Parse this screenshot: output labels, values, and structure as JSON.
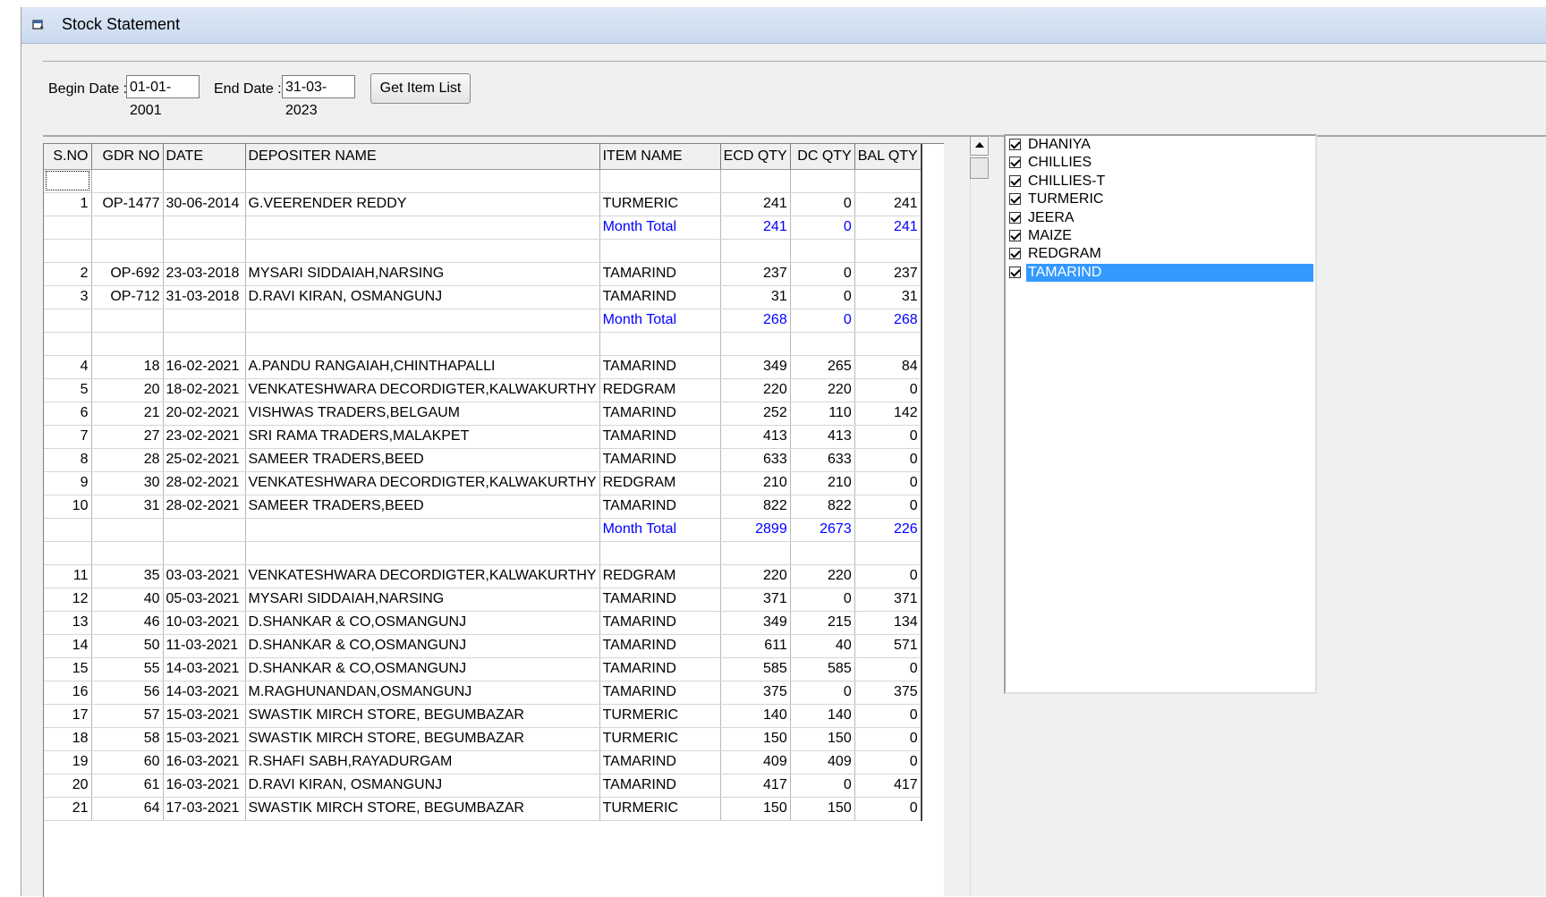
{
  "window": {
    "title": "Stock Statement",
    "icon": "form-icon"
  },
  "filters": {
    "begin_label": "Begin Date :",
    "begin_value": "01-01-2001",
    "end_label": "End Date :",
    "end_value": "31-03-2023",
    "button_label": "Get Item List"
  },
  "grid": {
    "columns": [
      "S.NO",
      "GDR NO",
      "DATE",
      "DEPOSITER NAME",
      "ITEM NAME",
      "ECD QTY",
      "DC QTY",
      "BAL QTY"
    ],
    "rows": [
      {
        "type": "blank",
        "cells": [
          "",
          "",
          "",
          "",
          "",
          "",
          "",
          ""
        ]
      },
      {
        "type": "data",
        "cells": [
          "1",
          "OP-1477",
          "30-06-2014",
          "G.VEERENDER REDDY",
          "TURMERIC",
          "241",
          "0",
          "241"
        ]
      },
      {
        "type": "total",
        "cells": [
          "",
          "",
          "",
          "",
          "Month Total",
          "241",
          "0",
          "241"
        ]
      },
      {
        "type": "blank",
        "cells": [
          "",
          "",
          "",
          "",
          "",
          "",
          "",
          ""
        ]
      },
      {
        "type": "data",
        "cells": [
          "2",
          "OP-692",
          "23-03-2018",
          "MYSARI SIDDAIAH,NARSING",
          "TAMARIND",
          "237",
          "0",
          "237"
        ]
      },
      {
        "type": "data",
        "cells": [
          "3",
          "OP-712",
          "31-03-2018",
          "D.RAVI KIRAN, OSMANGUNJ",
          "TAMARIND",
          "31",
          "0",
          "31"
        ]
      },
      {
        "type": "total",
        "cells": [
          "",
          "",
          "",
          "",
          "Month Total",
          "268",
          "0",
          "268"
        ]
      },
      {
        "type": "blank",
        "cells": [
          "",
          "",
          "",
          "",
          "",
          "",
          "",
          ""
        ]
      },
      {
        "type": "data",
        "cells": [
          "4",
          "18",
          "16-02-2021",
          "A.PANDU RANGAIAH,CHINTHAPALLI",
          "TAMARIND",
          "349",
          "265",
          "84"
        ]
      },
      {
        "type": "data",
        "cells": [
          "5",
          "20",
          "18-02-2021",
          "VENKATESHWARA DECORDIGTER,KALWAKURTHY",
          "REDGRAM",
          "220",
          "220",
          "0"
        ]
      },
      {
        "type": "data",
        "cells": [
          "6",
          "21",
          "20-02-2021",
          "VISHWAS TRADERS,BELGAUM",
          "TAMARIND",
          "252",
          "110",
          "142"
        ]
      },
      {
        "type": "data",
        "cells": [
          "7",
          "27",
          "23-02-2021",
          "SRI RAMA TRADERS,MALAKPET",
          "TAMARIND",
          "413",
          "413",
          "0"
        ]
      },
      {
        "type": "data",
        "cells": [
          "8",
          "28",
          "25-02-2021",
          "SAMEER TRADERS,BEED",
          "TAMARIND",
          "633",
          "633",
          "0"
        ]
      },
      {
        "type": "data",
        "cells": [
          "9",
          "30",
          "28-02-2021",
          "VENKATESHWARA DECORDIGTER,KALWAKURTHY",
          "REDGRAM",
          "210",
          "210",
          "0"
        ]
      },
      {
        "type": "data",
        "cells": [
          "10",
          "31",
          "28-02-2021",
          "SAMEER TRADERS,BEED",
          "TAMARIND",
          "822",
          "822",
          "0"
        ]
      },
      {
        "type": "total",
        "cells": [
          "",
          "",
          "",
          "",
          "Month Total",
          "2899",
          "2673",
          "226"
        ]
      },
      {
        "type": "blank",
        "cells": [
          "",
          "",
          "",
          "",
          "",
          "",
          "",
          ""
        ]
      },
      {
        "type": "data",
        "cells": [
          "11",
          "35",
          "03-03-2021",
          "VENKATESHWARA DECORDIGTER,KALWAKURTHY",
          "REDGRAM",
          "220",
          "220",
          "0"
        ]
      },
      {
        "type": "data",
        "cells": [
          "12",
          "40",
          "05-03-2021",
          "MYSARI SIDDAIAH,NARSING",
          "TAMARIND",
          "371",
          "0",
          "371"
        ]
      },
      {
        "type": "data",
        "cells": [
          "13",
          "46",
          "10-03-2021",
          "D.SHANKAR & CO,OSMANGUNJ",
          "TAMARIND",
          "349",
          "215",
          "134"
        ]
      },
      {
        "type": "data",
        "cells": [
          "14",
          "50",
          "11-03-2021",
          "D.SHANKAR & CO,OSMANGUNJ",
          "TAMARIND",
          "611",
          "40",
          "571"
        ]
      },
      {
        "type": "data",
        "cells": [
          "15",
          "55",
          "14-03-2021",
          "D.SHANKAR & CO,OSMANGUNJ",
          "TAMARIND",
          "585",
          "585",
          "0"
        ]
      },
      {
        "type": "data",
        "cells": [
          "16",
          "56",
          "14-03-2021",
          "M.RAGHUNANDAN,OSMANGUNJ",
          "TAMARIND",
          "375",
          "0",
          "375"
        ]
      },
      {
        "type": "data",
        "cells": [
          "17",
          "57",
          "15-03-2021",
          "SWASTIK MIRCH STORE, BEGUMBAZAR",
          "TURMERIC",
          "140",
          "140",
          "0"
        ]
      },
      {
        "type": "data",
        "cells": [
          "18",
          "58",
          "15-03-2021",
          "SWASTIK MIRCH STORE, BEGUMBAZAR",
          "TURMERIC",
          "150",
          "150",
          "0"
        ]
      },
      {
        "type": "data",
        "cells": [
          "19",
          "60",
          "16-03-2021",
          "R.SHAFI SABH,RAYADURGAM",
          "TAMARIND",
          "409",
          "409",
          "0"
        ]
      },
      {
        "type": "data",
        "cells": [
          "20",
          "61",
          "16-03-2021",
          "D.RAVI KIRAN, OSMANGUNJ",
          "TAMARIND",
          "417",
          "0",
          "417"
        ]
      },
      {
        "type": "data",
        "cells": [
          "21",
          "64",
          "17-03-2021",
          "SWASTIK MIRCH STORE, BEGUMBAZAR",
          "TURMERIC",
          "150",
          "150",
          "0"
        ]
      }
    ]
  },
  "items": [
    {
      "label": "DHANIYA",
      "checked": true,
      "selected": false
    },
    {
      "label": "CHILLIES",
      "checked": true,
      "selected": false
    },
    {
      "label": "CHILLIES-T",
      "checked": true,
      "selected": false
    },
    {
      "label": "TURMERIC",
      "checked": true,
      "selected": false
    },
    {
      "label": "JEERA",
      "checked": true,
      "selected": false
    },
    {
      "label": "MAIZE",
      "checked": true,
      "selected": false
    },
    {
      "label": "REDGRAM",
      "checked": true,
      "selected": false
    },
    {
      "label": "TAMARIND",
      "checked": true,
      "selected": true
    }
  ],
  "colors": {
    "total_text": "#0000ff",
    "selection": "#3399ff",
    "titlebar": "#d4e1f2"
  }
}
